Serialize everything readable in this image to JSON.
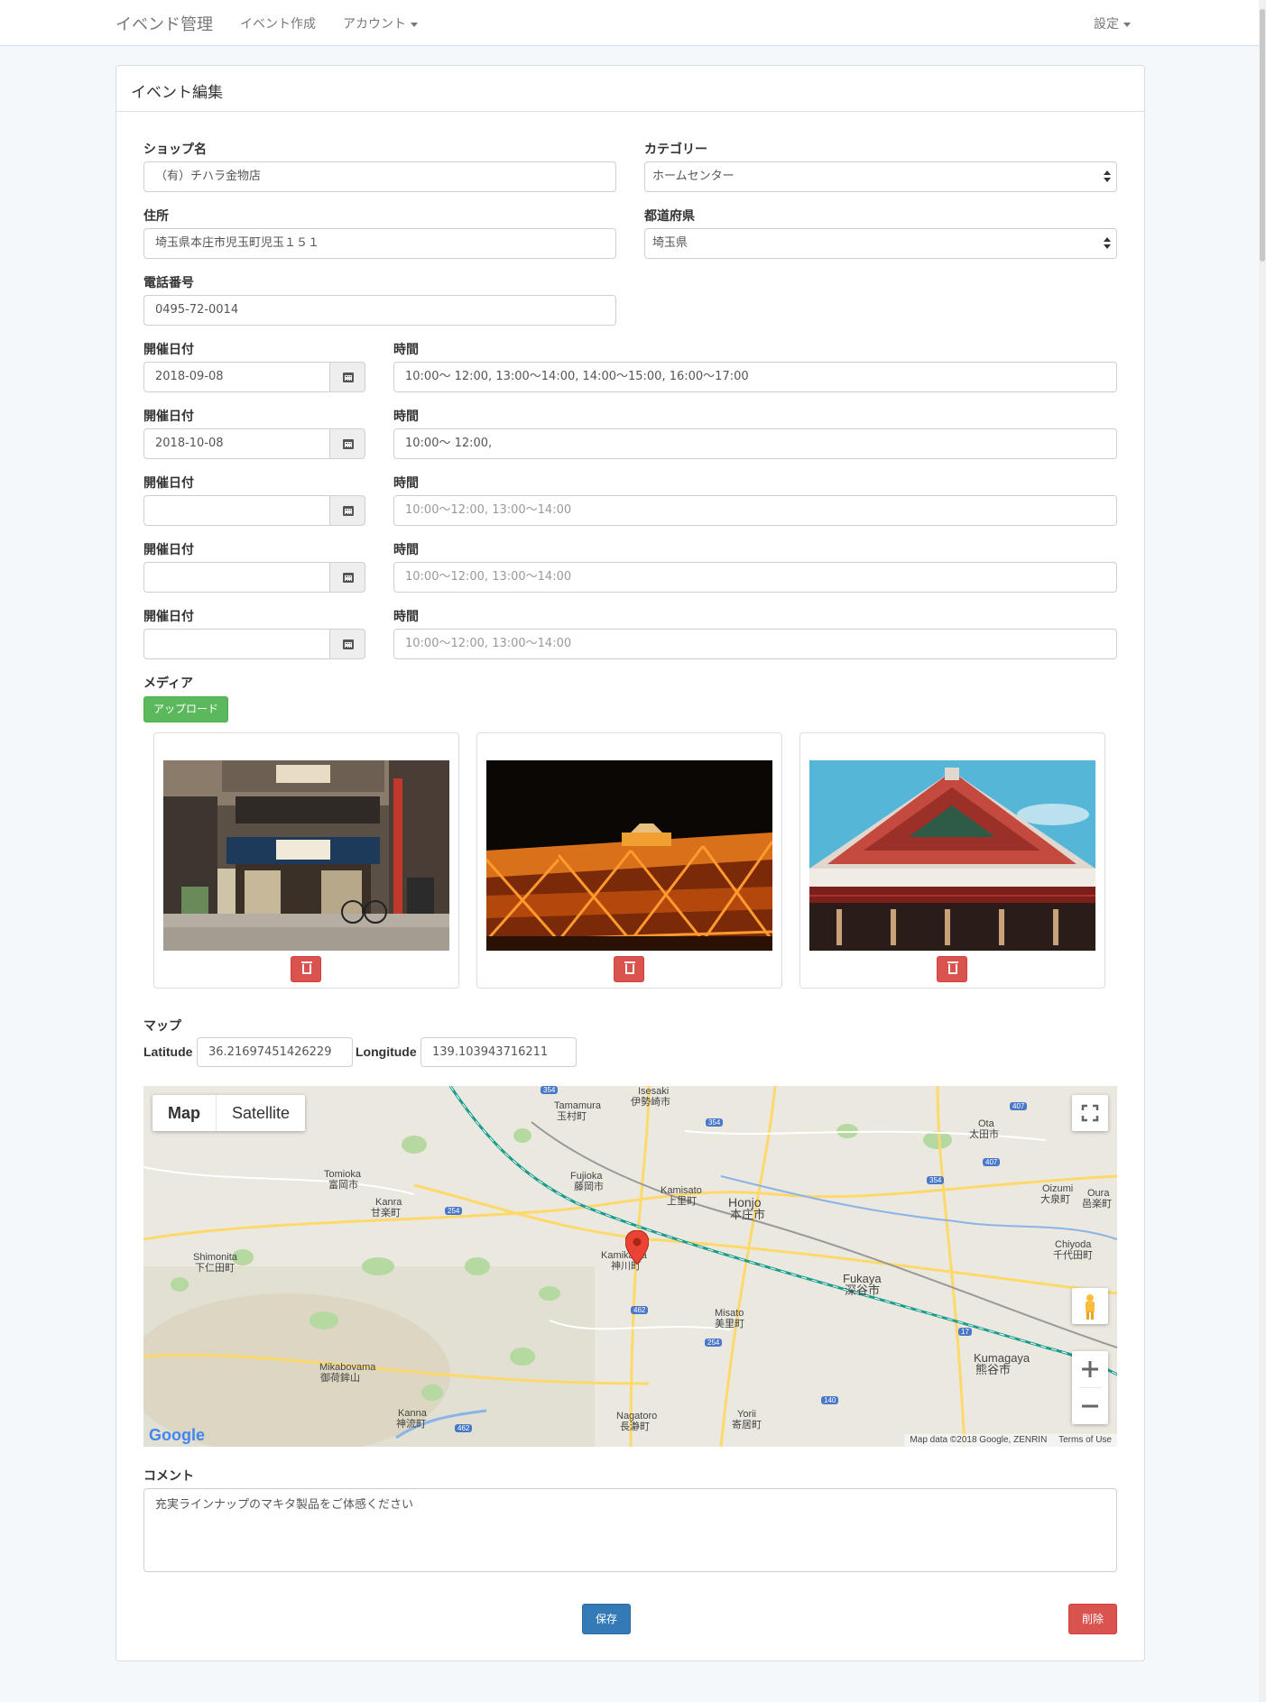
{
  "navbar": {
    "brand": "イベンド管理",
    "create_event": "イベント作成",
    "account": "アカウント",
    "settings": "設定"
  },
  "panel": {
    "title": "イベント編集"
  },
  "form": {
    "shop_name": {
      "label": "ショップ名",
      "value": "（有）チハラ金物店"
    },
    "category": {
      "label": "カテゴリー",
      "value": "ホームセンター"
    },
    "address": {
      "label": "住所",
      "value": "埼玉県本庄市児玉町児玉１５１"
    },
    "prefecture": {
      "label": "都道府県",
      "value": "埼玉県"
    },
    "phone": {
      "label": "電話番号",
      "value": "0495-72-0014"
    },
    "schedule_date_label": "開催日付",
    "schedule_time_label": "時間",
    "schedules": [
      {
        "date": "2018-09-08",
        "time": "10:00〜 12:00, 13:00〜14:00, 14:00〜15:00, 16:00〜17:00",
        "time_placeholder": ""
      },
      {
        "date": "2018-10-08",
        "time": "10:00〜 12:00,",
        "time_placeholder": ""
      },
      {
        "date": "",
        "time": "",
        "time_placeholder": "10:00〜12:00, 13:00〜14:00"
      },
      {
        "date": "",
        "time": "",
        "time_placeholder": "10:00〜12:00, 13:00〜14:00"
      },
      {
        "date": "",
        "time": "",
        "time_placeholder": "10:00〜12:00, 13:00〜14:00"
      }
    ],
    "media": {
      "label": "メディア",
      "upload_button": "アップロード"
    },
    "map": {
      "label": "マップ",
      "latitude_label": "Latitude",
      "latitude": "36.21697451426229",
      "longitude_label": "Longitude",
      "longitude": "139.103943716211",
      "type_map": "Map",
      "type_satellite": "Satellite",
      "attribution": "Map data ©2018 Google, ZENRIN",
      "terms": "Terms of Use",
      "google": "Google",
      "places": [
        {
          "name": "Isesaki",
          "jp": "伊勢崎市"
        },
        {
          "name": "Tamamura",
          "jp": "玉村町"
        },
        {
          "name": "Ota",
          "jp": "太田市"
        },
        {
          "name": "Tomioka",
          "jp": "富岡市"
        },
        {
          "name": "Fujioka",
          "jp": "藤岡市"
        },
        {
          "name": "Kamisato",
          "jp": "上里町"
        },
        {
          "name": "Honjo",
          "jp": "本庄市"
        },
        {
          "name": "Kanra",
          "jp": "甘楽町"
        },
        {
          "name": "Oizumi",
          "jp": "大泉町"
        },
        {
          "name": "Oura",
          "jp": "邑楽町"
        },
        {
          "name": "Shimonita",
          "jp": "下仁田町"
        },
        {
          "name": "Kamikawa",
          "jp": "神川町"
        },
        {
          "name": "Chiyoda",
          "jp": "千代田町"
        },
        {
          "name": "Fukaya",
          "jp": "深谷市"
        },
        {
          "name": "Misato",
          "jp": "美里町"
        },
        {
          "name": "Mikabovama",
          "jp": "御荷鉾山"
        },
        {
          "name": "Kumagaya",
          "jp": "熊谷市"
        },
        {
          "name": "Kanna",
          "jp": "神流町"
        },
        {
          "name": "Nagatoro",
          "jp": "長瀞町"
        },
        {
          "name": "Yorii",
          "jp": "寄居町"
        }
      ]
    },
    "comment": {
      "label": "コメント",
      "value": "充実ラインナップのマキタ製品をご体感ください"
    },
    "save_button": "保存",
    "delete_button": "削除"
  },
  "colors": {
    "primary": "#337ab7",
    "danger": "#d9534f",
    "success": "#5cb85c"
  }
}
